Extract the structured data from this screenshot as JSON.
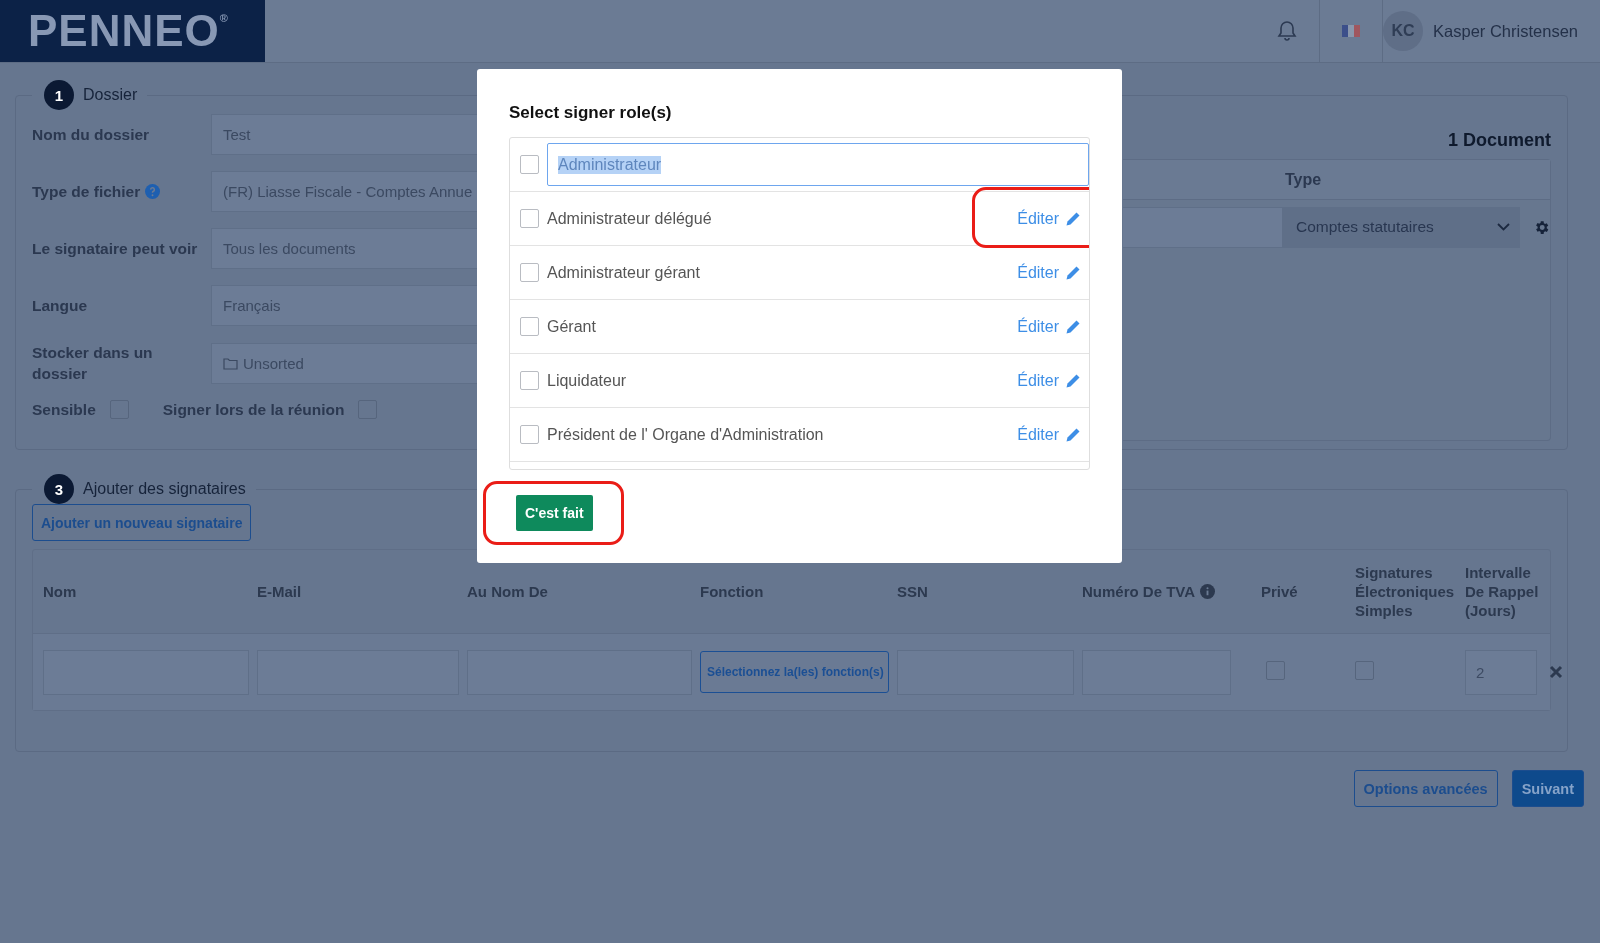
{
  "header": {
    "logo": "PENNEO",
    "logo_mark": "®",
    "user": {
      "initials": "KC",
      "name": "Kasper Christensen"
    }
  },
  "dossier": {
    "step": "1",
    "title": "Dossier",
    "fields": [
      {
        "label": "Nom du dossier",
        "value": "Test",
        "kind": "text",
        "help": false
      },
      {
        "label": "Type de fichier",
        "value": "(FR) Liasse Fiscale - Comptes Annue",
        "kind": "text",
        "help": true
      },
      {
        "label": "Le signataire peut voir",
        "value": "Tous les documents",
        "kind": "text",
        "help": false
      },
      {
        "label": "Langue",
        "value": "Français",
        "kind": "text",
        "help": false
      },
      {
        "label": "Stocker dans un dossier",
        "value": "Unsorted",
        "kind": "folder",
        "help": false
      }
    ],
    "toggles": [
      {
        "label": "Sensible",
        "checked": false
      },
      {
        "label": "Signer lors de la réunion",
        "checked": false
      }
    ],
    "documents": {
      "count": "1 Document",
      "columns": [
        "Type"
      ],
      "rows": [
        {
          "type": "Comptes statutaires"
        }
      ]
    }
  },
  "signers": {
    "step": "3",
    "title": "Ajouter des signataires",
    "add_button": "Ajouter un nouveau signataire",
    "columns": [
      {
        "label": "Nom",
        "info": false
      },
      {
        "label": "E-Mail",
        "info": false
      },
      {
        "label": "Au Nom De",
        "info": false
      },
      {
        "label": "Fonction",
        "info": false
      },
      {
        "label": "SSN",
        "info": false
      },
      {
        "label": "Numéro De TVA",
        "info": true
      },
      {
        "label": "Privé",
        "info": false
      },
      {
        "label": "Signatures Électroniques Simples",
        "info": false
      },
      {
        "label": "Intervalle De Rappel (Jours)",
        "info": false
      }
    ],
    "rows": [
      {
        "function_button": "Sélectionnez la(les) fonction(s)",
        "private": false,
        "simple_signatures": false,
        "interval": "2"
      }
    ]
  },
  "actions": [
    {
      "label": "Options avancées",
      "kind": "secondary"
    },
    {
      "label": "Suivant",
      "kind": "primary"
    }
  ],
  "modal": {
    "title": "Select signer role(s)",
    "roles": [
      {
        "label": "Administrateur",
        "kind": "editing",
        "checked": false,
        "highlighted": false
      },
      {
        "label": "Administrateur délégué",
        "kind": "view",
        "edit": "Éditer",
        "checked": false,
        "highlighted": true
      },
      {
        "label": "Administrateur gérant",
        "kind": "view",
        "edit": "Éditer",
        "checked": false,
        "highlighted": false
      },
      {
        "label": "Gérant",
        "kind": "view",
        "edit": "Éditer",
        "checked": false,
        "highlighted": false
      },
      {
        "label": "Liquidateur",
        "kind": "view",
        "edit": "Éditer",
        "checked": false,
        "highlighted": false
      },
      {
        "label": "Président de l' Organe d'Administration",
        "kind": "view",
        "edit": "Éditer",
        "checked": false,
        "highlighted": false
      }
    ],
    "done": "C'est fait",
    "done_highlighted": true
  }
}
